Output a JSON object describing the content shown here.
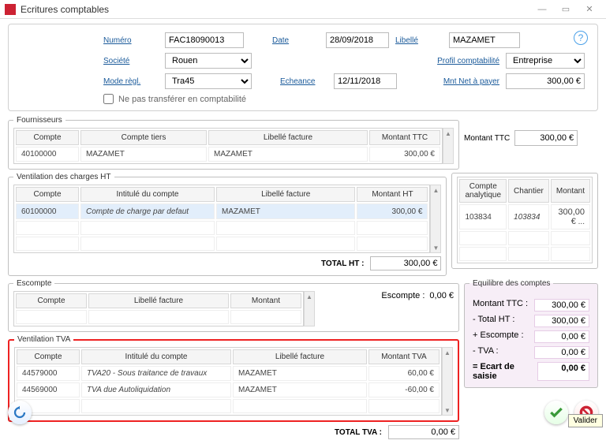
{
  "window": {
    "title": "Ecritures comptables"
  },
  "form": {
    "numero_lbl": "Numéro",
    "numero": "FAC18090013",
    "date_lbl": "Date",
    "date": "28/09/2018",
    "libelle_lbl": "Libellé",
    "libelle": "MAZAMET",
    "societe_lbl": "Société",
    "societe": "Rouen",
    "profil_lbl": "Profil comptabilité",
    "profil": "Entreprise",
    "mode_lbl": "Mode règl.",
    "mode": "Tra45",
    "echeance_lbl": "Echeance",
    "echeance": "12/11/2018",
    "mntnet_lbl": "Mnt Net à payer",
    "mntnet": "300,00 €",
    "notransfer": "Ne pas transférer en comptabilité"
  },
  "fournisseurs": {
    "legend": "Fournisseurs",
    "cols": {
      "compte": "Compte",
      "tiers": "Compte tiers",
      "libelle": "Libellé facture",
      "ttc": "Montant TTC"
    },
    "row": {
      "compte": "40100000",
      "tiers": "MAZAMET",
      "libelle": "MAZAMET",
      "ttc": "300,00 €"
    },
    "side_lbl": "Montant TTC",
    "side_val": "300,00 €"
  },
  "charges": {
    "legend": "Ventilation des charges HT",
    "cols": {
      "compte": "Compte",
      "intitule": "Intitulé du compte",
      "libelle": "Libellé facture",
      "ht": "Montant HT"
    },
    "row": {
      "compte": "60100000",
      "intitule": "Compte de charge par defaut",
      "libelle": "MAZAMET",
      "ht": "300,00 €"
    },
    "total_lbl": "TOTAL HT :",
    "total": "300,00 €",
    "anal_cols": {
      "analytique": "Compte analytique",
      "chantier": "Chantier",
      "montant": "Montant"
    },
    "anal_row": {
      "analytique": "103834",
      "chantier": "103834",
      "montant": "300,00 €"
    }
  },
  "escompte": {
    "legend": "Escompte",
    "cols": {
      "compte": "Compte",
      "libelle": "Libellé facture",
      "montant": "Montant"
    },
    "total_lbl": "Escompte :",
    "total": "0,00 €"
  },
  "tva": {
    "legend": "Ventilation TVA",
    "cols": {
      "compte": "Compte",
      "intitule": "Intitulé du compte",
      "libelle": "Libellé facture",
      "tva": "Montant TVA"
    },
    "rows": [
      {
        "compte": "44579000",
        "intitule": "TVA20 - Sous traitance de travaux",
        "libelle": "MAZAMET",
        "tva": "60,00 €"
      },
      {
        "compte": "44569000",
        "intitule": "TVA due Autoliquidation",
        "libelle": "MAZAMET",
        "tva": "-60,00 €"
      }
    ],
    "total_lbl": "TOTAL TVA :",
    "total": "0,00 €"
  },
  "equilibre": {
    "legend": "Equilibre des comptes",
    "rows": [
      {
        "lbl": "Montant TTC :",
        "val": "300,00 €"
      },
      {
        "lbl": "- Total HT :",
        "val": "300,00 €"
      },
      {
        "lbl": "+ Escompte :",
        "val": "0,00 €"
      },
      {
        "lbl": "- TVA :",
        "val": "0,00 €"
      },
      {
        "lbl": "= Ecart de saisie",
        "val": "0,00 €"
      }
    ]
  },
  "footer": {
    "valider_tip": "Valider"
  }
}
